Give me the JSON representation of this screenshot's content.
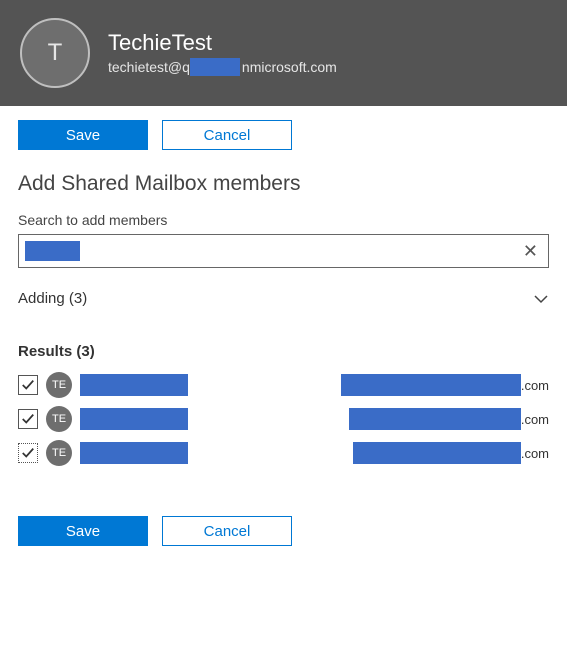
{
  "header": {
    "avatar_initial": "T",
    "title": "TechieTest",
    "email_prefix": "techietest@q",
    "email_suffix": "nmicrosoft.com"
  },
  "buttons": {
    "save": "Save",
    "cancel": "Cancel"
  },
  "section_title": "Add Shared Mailbox members",
  "search": {
    "label": "Search to add members",
    "value": "",
    "clear_glyph": "✕"
  },
  "adding": {
    "label": "Adding (3)"
  },
  "results": {
    "title": "Results (3)",
    "rows": [
      {
        "checked": true,
        "dotted": false,
        "initials": "TE",
        "email_suffix": ".com",
        "email_redact_w": 180
      },
      {
        "checked": true,
        "dotted": false,
        "initials": "TE",
        "email_suffix": ".com",
        "email_redact_w": 172
      },
      {
        "checked": true,
        "dotted": true,
        "initials": "TE",
        "email_suffix": ".com",
        "email_redact_w": 168
      }
    ]
  }
}
